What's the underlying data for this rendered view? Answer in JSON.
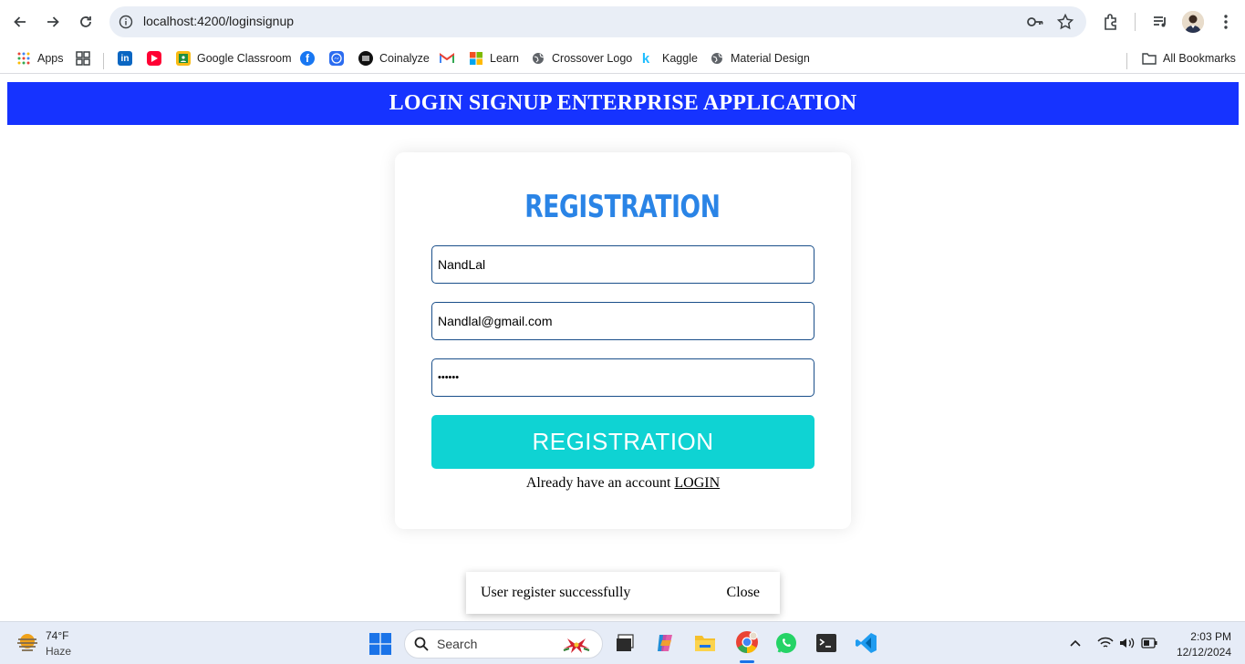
{
  "browser": {
    "url": "localhost:4200/loginsignup",
    "bookmarks": [
      {
        "label": "Apps",
        "icon": "apps-grid-icon"
      },
      {
        "label": "",
        "icon": "tab-groups-icon"
      },
      {
        "label": "",
        "icon": "linkedin-icon"
      },
      {
        "label": "",
        "icon": "youtube-icon"
      },
      {
        "label": "Google Classroom",
        "icon": "google-classroom-icon"
      },
      {
        "label": "",
        "icon": "facebook-icon"
      },
      {
        "label": "",
        "icon": "messenger-icon"
      },
      {
        "label": "Coinalyze",
        "icon": "coinalyze-icon"
      },
      {
        "label": "",
        "icon": "gmail-icon"
      },
      {
        "label": "Learn",
        "icon": "microsoft-icon"
      },
      {
        "label": "Crossover Logo",
        "icon": "globe-icon"
      },
      {
        "label": "Kaggle",
        "icon": "kaggle-icon"
      },
      {
        "label": "Material Design",
        "icon": "globe-icon"
      }
    ],
    "all_bookmarks": "All Bookmarks"
  },
  "app": {
    "header_title": "LOGIN SIGNUP ENTERPRISE APPLICATION",
    "form_title": "REGISTRATION",
    "name_value": "NandLal",
    "email_value": "Nandlal@gmail.com",
    "password_value": "••••••",
    "submit_label": "REGISTRATION",
    "already_text": "Already have an account",
    "login_link": "LOGIN",
    "colors": {
      "header": "#1633ff",
      "title": "#2a84e6",
      "button": "#0fd3d3"
    }
  },
  "snackbar": {
    "message": "User register successfully",
    "action": "Close"
  },
  "taskbar": {
    "weather_temp": "74°F",
    "weather_cond": "Haze",
    "search_placeholder": "Search",
    "time": "2:03 PM",
    "date": "12/12/2024"
  }
}
